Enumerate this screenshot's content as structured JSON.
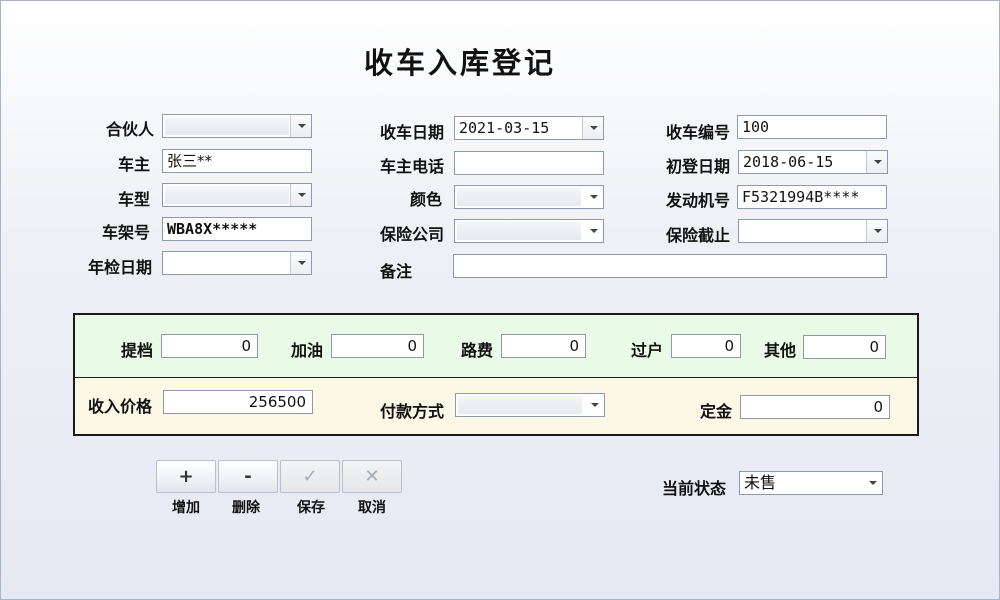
{
  "title": "收车入库登记",
  "form": {
    "partner": {
      "label": "合伙人",
      "value": ""
    },
    "owner": {
      "label": "车主",
      "value": "张三**"
    },
    "model": {
      "label": "车型",
      "value": ""
    },
    "vin": {
      "label": "车架号",
      "value": "WBA8X*****"
    },
    "inspection_date": {
      "label": "年检日期",
      "value": ""
    },
    "receive_date": {
      "label": "收车日期",
      "value": "2021-03-15"
    },
    "owner_phone": {
      "label": "车主电话",
      "value": ""
    },
    "color": {
      "label": "颜色",
      "value": ""
    },
    "insurer": {
      "label": "保险公司",
      "value": ""
    },
    "remark": {
      "label": "备注",
      "value": ""
    },
    "receive_no": {
      "label": "收车编号",
      "value": "100"
    },
    "first_reg_date": {
      "label": "初登日期",
      "value": "2018-06-15"
    },
    "engine_no": {
      "label": "发动机号",
      "value": "F5321994B****"
    },
    "insurance_expiry": {
      "label": "保险截止",
      "value": ""
    }
  },
  "fees": {
    "towing": {
      "label": "提档",
      "value": "0"
    },
    "fuel": {
      "label": "加油",
      "value": "0"
    },
    "toll": {
      "label": "路费",
      "value": "0"
    },
    "transfer": {
      "label": "过户",
      "value": "0"
    },
    "other": {
      "label": "其他",
      "value": "0"
    }
  },
  "purchase": {
    "price": {
      "label": "收入价格",
      "value": "256500"
    },
    "payment": {
      "label": "付款方式",
      "value": ""
    },
    "deposit": {
      "label": "定金",
      "value": "0"
    }
  },
  "buttons": {
    "add": {
      "icon": "+",
      "label": "增加"
    },
    "delete": {
      "icon": "-",
      "label": "删除"
    },
    "save": {
      "icon": "✓",
      "label": "保存"
    },
    "cancel": {
      "icon": "✕",
      "label": "取消"
    }
  },
  "status": {
    "label": "当前状态",
    "value": "未售"
  }
}
